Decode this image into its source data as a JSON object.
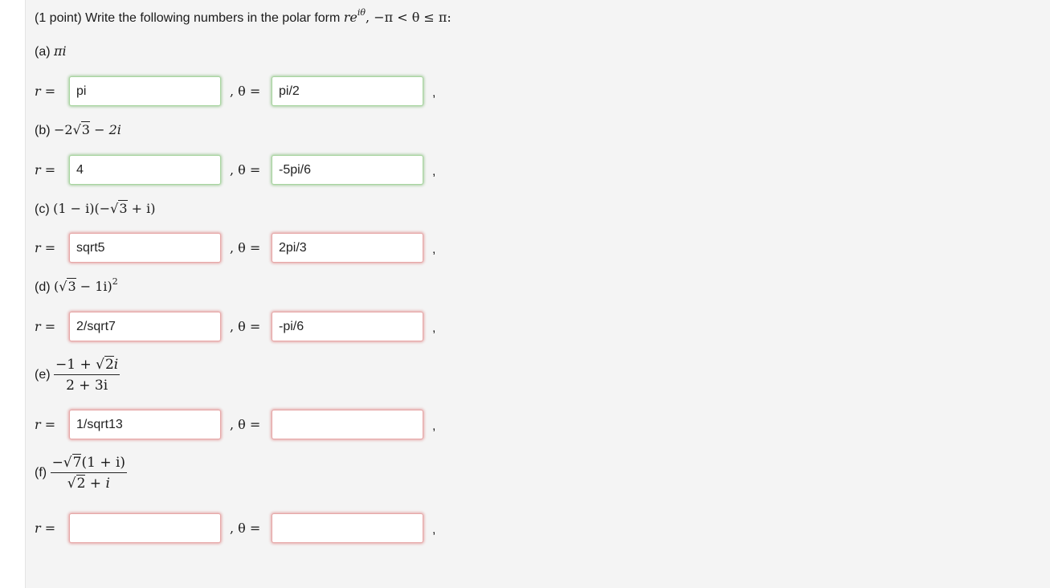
{
  "header": {
    "prefix": "(1 point) Write the following numbers in the polar form ",
    "form_base": "re",
    "form_exp": "iθ",
    "range": ", −π < θ ≤ π:"
  },
  "labels": {
    "r": "r =",
    "theta": ", θ =",
    "trail": ","
  },
  "parts": [
    {
      "tag": "(a)",
      "expr": "πi",
      "r_value": "pi",
      "theta_value": "pi/2",
      "r_status": "correct",
      "theta_status": "correct"
    },
    {
      "tag": "(b)",
      "expr_a": "−2√",
      "expr_rad": "3",
      "expr_b": " − 2i",
      "r_value": "4",
      "theta_value": "-5pi/6",
      "r_status": "correct",
      "theta_status": "correct"
    },
    {
      "tag": "(c)",
      "expr_a": "(1 − i)(−√",
      "expr_rad": "3",
      "expr_b": " + i)",
      "r_value": "sqrt5",
      "theta_value": "2pi/3",
      "r_status": "incorrect",
      "theta_status": "incorrect"
    },
    {
      "tag": "(d)",
      "expr_a": "(√",
      "expr_rad": "3",
      "expr_b": " − 1i)",
      "expr_exp": "2",
      "r_value": "2/sqrt7",
      "theta_value": "-pi/6",
      "r_status": "incorrect",
      "theta_status": "incorrect"
    },
    {
      "tag": "(e)",
      "num_a": "−1 + √",
      "num_rad": "2",
      "num_b": "i",
      "den": "2 + 3i",
      "r_value": "1/sqrt13",
      "theta_value": "",
      "r_status": "incorrect",
      "theta_status": "incorrect"
    },
    {
      "tag": "(f)",
      "num_a": "−√",
      "num_rad": "7",
      "num_b": "(1 + i)",
      "den_a": "√",
      "den_rad": "2",
      "den_b": " + i",
      "r_value": "",
      "theta_value": "",
      "r_status": "incorrect",
      "theta_status": "incorrect"
    }
  ]
}
